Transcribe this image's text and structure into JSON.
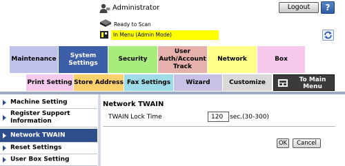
{
  "header": {
    "user_label": "Administrator",
    "logout_label": "Logout",
    "help_label": "?",
    "status_label": "Ready to Scan",
    "mode_label": "In Menu (Admin Mode)"
  },
  "main_tabs": [
    {
      "label": "Maintenance",
      "color": "#bfc3ec",
      "active": false
    },
    {
      "label": "System Settings",
      "color": "#3d5fa8",
      "active": true
    },
    {
      "label": "Security",
      "color": "#a8ec7e",
      "active": false
    },
    {
      "label": "User Auth/Account Track",
      "color": "#e6b0ac",
      "active": false
    },
    {
      "label": "Network",
      "color": "#ffff8a",
      "active": false
    },
    {
      "label": "Box",
      "color": "#f6c9ec",
      "active": false
    }
  ],
  "sub_tabs": [
    {
      "label": "Print Setting",
      "color": "#f6c9ec"
    },
    {
      "label": "Store Address",
      "color": "#ffd06b"
    },
    {
      "label": "Fax Settings",
      "color": "#9cdbe7"
    },
    {
      "label": "Wizard",
      "color": "#c9c0e6"
    },
    {
      "label": "Customize",
      "color": "#d9d9d9"
    }
  ],
  "to_main_menu_label": "To Main Menu",
  "sidebar": {
    "items": [
      {
        "label": "Machine Setting",
        "active": false
      },
      {
        "label": "Register Support Information",
        "active": false
      },
      {
        "label": "Network TWAIN",
        "active": true
      },
      {
        "label": "Reset Settings",
        "active": false
      },
      {
        "label": "User Box Setting",
        "active": false
      }
    ]
  },
  "content": {
    "title": "Network TWAIN",
    "field_label": "TWAIN Lock Time",
    "field_value": "120",
    "field_unit": "sec.(30-300)",
    "ok_label": "OK",
    "cancel_label": "Cancel"
  }
}
